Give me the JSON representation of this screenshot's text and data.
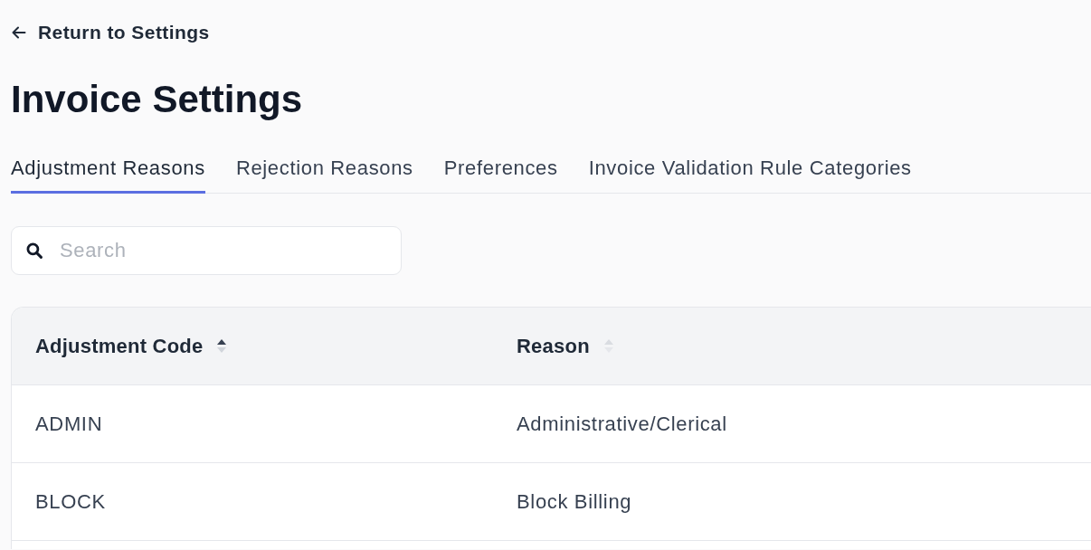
{
  "back_link": {
    "label": "Return to Settings"
  },
  "page_title": "Invoice Settings",
  "tabs": [
    {
      "label": "Adjustment Reasons",
      "selected": true
    },
    {
      "label": "Rejection Reasons",
      "selected": false
    },
    {
      "label": "Preferences",
      "selected": false
    },
    {
      "label": "Invoice Validation Rule Categories",
      "selected": false
    }
  ],
  "search": {
    "placeholder": "Search"
  },
  "table": {
    "columns": [
      {
        "label": "Adjustment Code",
        "sorted": true
      },
      {
        "label": "Reason",
        "sorted": false
      }
    ],
    "rows": [
      [
        "ADMIN",
        "Administrative/Clerical"
      ],
      [
        "BLOCK",
        "Block Billing"
      ]
    ]
  }
}
